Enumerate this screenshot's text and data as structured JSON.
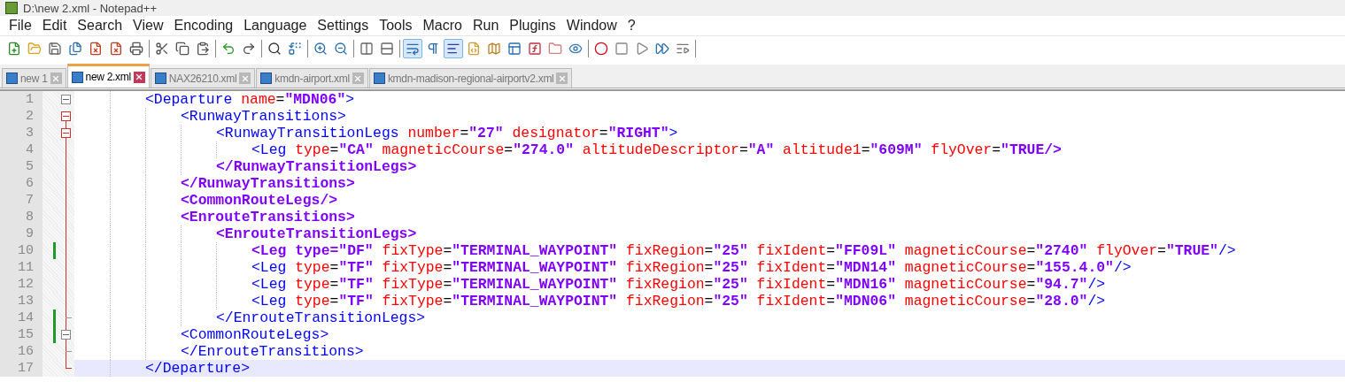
{
  "window": {
    "title": "D:\\new 2.xml - Notepad++"
  },
  "menu": [
    "File",
    "Edit",
    "Search",
    "View",
    "Encoding",
    "Language",
    "Settings",
    "Tools",
    "Macro",
    "Run",
    "Plugins",
    "Window",
    "?"
  ],
  "toolbar": [
    [
      {
        "pressed": false
      },
      {
        "pressed": false
      },
      {
        "pressed": false
      },
      {
        "pressed": false
      },
      {
        "pressed": false
      },
      {
        "pressed": false
      },
      {
        "pressed": false
      }
    ],
    [
      {
        "pressed": false
      },
      {
        "pressed": false
      },
      {
        "pressed": false
      }
    ],
    [
      {
        "pressed": false
      },
      {
        "pressed": false
      }
    ],
    [
      {
        "pressed": false
      },
      {
        "pressed": false
      }
    ],
    [
      {
        "pressed": false
      },
      {
        "pressed": false
      }
    ],
    [
      {
        "pressed": false
      },
      {
        "pressed": false
      }
    ],
    [
      {
        "pressed": true
      },
      {
        "pressed": false
      },
      {
        "pressed": true
      },
      {
        "pressed": false
      },
      {
        "pressed": false
      },
      {
        "pressed": false
      },
      {
        "pressed": false
      },
      {
        "pressed": false
      },
      {
        "pressed": false
      }
    ],
    [
      {
        "pressed": false
      },
      {
        "pressed": false
      },
      {
        "pressed": false
      },
      {
        "pressed": false
      },
      {
        "pressed": false
      }
    ]
  ],
  "tabs": [
    {
      "label": "new 1",
      "selected": false
    },
    {
      "label": "new 2.xml",
      "selected": true
    },
    {
      "label": "NAX26210.xml",
      "selected": false
    },
    {
      "label": "kmdn-airport.xml",
      "selected": false
    },
    {
      "label": "kmdn-madison-regional-airportv2.xml",
      "selected": false
    }
  ],
  "editor": {
    "lines": [
      {
        "number": "1",
        "kind": "box",
        "in_block": false,
        "changed": false,
        "current": false,
        "tokens": [
          {
            "kind": "tag",
            "text": "<Departure"
          },
          {
            "kind": "attr",
            "text": " name"
          },
          {
            "kind": "eq",
            "text": "="
          },
          {
            "kind": "value",
            "text": "\"MDN06\""
          },
          {
            "kind": "tag",
            "text": ">"
          }
        ],
        "children": [
          {
            "number": "2",
            "kind": "box-active",
            "in_block": true,
            "changed": false,
            "current": false,
            "tokens": [
              {
                "kind": "tag",
                "text": "<RunwayTransitions>"
              }
            ],
            "children": [
              {
                "number": "3",
                "kind": "box-active",
                "in_block": true,
                "changed": false,
                "current": false,
                "tokens": [
                  {
                    "kind": "tag",
                    "text": "<RunwayTransitionLegs"
                  },
                  {
                    "kind": "attr",
                    "text": " number"
                  },
                  {
                    "kind": "eq",
                    "text": "="
                  },
                  {
                    "kind": "value",
                    "text": "\"27\""
                  },
                  {
                    "kind": "attr",
                    "text": " designator"
                  },
                  {
                    "kind": "eq",
                    "text": "="
                  },
                  {
                    "kind": "value",
                    "text": "\"RIGHT\""
                  },
                  {
                    "kind": "tag",
                    "text": ">"
                  }
                ],
                "children": [
                  {
                    "number": "4",
                    "in_block": true,
                    "changed": false,
                    "current": false,
                    "tokens": [
                      {
                        "kind": "tag",
                        "text": "<Leg"
                      },
                      {
                        "kind": "attr",
                        "text": " type"
                      },
                      {
                        "kind": "eq",
                        "text": "="
                      },
                      {
                        "kind": "value",
                        "text": "\"CA\""
                      },
                      {
                        "kind": "attr",
                        "text": " magneticCourse"
                      },
                      {
                        "kind": "eq",
                        "text": "="
                      },
                      {
                        "kind": "value",
                        "text": "\"274.0\""
                      },
                      {
                        "kind": "attr",
                        "text": " altitudeDescriptor"
                      },
                      {
                        "kind": "eq",
                        "text": "="
                      },
                      {
                        "kind": "value",
                        "text": "\"A\""
                      },
                      {
                        "kind": "attr",
                        "text": " altitude1"
                      },
                      {
                        "kind": "eq",
                        "text": "="
                      },
                      {
                        "kind": "value",
                        "text": "\"609M\""
                      },
                      {
                        "kind": "attr",
                        "text": " flyOver"
                      },
                      {
                        "kind": "eq",
                        "text": "="
                      },
                      {
                        "kind": "value",
                        "text": "\"TRUE/>"
                      }
                    ]
                  }
                ]
              },
              {
                "number": "5",
                "in_block": true,
                "changed": false,
                "current": false,
                "tokens": [
                  {
                    "kind": "value",
                    "text": "</RunwayTransitionLegs>"
                  }
                ]
              }
            ]
          },
          {
            "number": "6",
            "in_block": true,
            "changed": false,
            "current": false,
            "tokens": [
              {
                "kind": "value",
                "text": "</RunwayTransitions>"
              }
            ]
          },
          {
            "number": "7",
            "in_block": true,
            "changed": false,
            "current": false,
            "tokens": [
              {
                "kind": "value",
                "text": "<CommonRouteLegs/>"
              }
            ]
          },
          {
            "number": "8",
            "in_block": true,
            "changed": false,
            "current": false,
            "tokens": [
              {
                "kind": "value",
                "text": "<EnrouteTransitions>"
              }
            ],
            "children": [
              {
                "number": "9",
                "in_block": true,
                "changed": false,
                "current": false,
                "tokens": [
                  {
                    "kind": "value",
                    "text": "<EnrouteTransitionLegs>"
                  }
                ],
                "children": [
                  {
                    "number": "10",
                    "in_block": true,
                    "changed": true,
                    "current": false,
                    "tokens": [
                      {
                        "kind": "value",
                        "text": "<Leg type=\"DF\""
                      },
                      {
                        "kind": "attr",
                        "text": " fixType"
                      },
                      {
                        "kind": "eq",
                        "text": "="
                      },
                      {
                        "kind": "value",
                        "text": "\"TERMINAL_WAYPOINT\""
                      },
                      {
                        "kind": "attr",
                        "text": " fixRegion"
                      },
                      {
                        "kind": "eq",
                        "text": "="
                      },
                      {
                        "kind": "value",
                        "text": "\"25\""
                      },
                      {
                        "kind": "attr",
                        "text": " fixIdent"
                      },
                      {
                        "kind": "eq",
                        "text": "="
                      },
                      {
                        "kind": "value",
                        "text": "\"FF09L\""
                      },
                      {
                        "kind": "attr",
                        "text": " magneticCourse"
                      },
                      {
                        "kind": "eq",
                        "text": "="
                      },
                      {
                        "kind": "value",
                        "text": "\"2740\""
                      },
                      {
                        "kind": "attr",
                        "text": " flyOver"
                      },
                      {
                        "kind": "eq",
                        "text": "="
                      },
                      {
                        "kind": "value",
                        "text": "\"TRUE\""
                      },
                      {
                        "kind": "tag",
                        "text": "/>"
                      }
                    ]
                  },
                  {
                    "number": "11",
                    "in_block": true,
                    "changed": false,
                    "current": false,
                    "tokens": [
                      {
                        "kind": "tag",
                        "text": "<Leg"
                      },
                      {
                        "kind": "attr",
                        "text": " type"
                      },
                      {
                        "kind": "eq",
                        "text": "="
                      },
                      {
                        "kind": "value",
                        "text": "\"TF\""
                      },
                      {
                        "kind": "attr",
                        "text": " fixType"
                      },
                      {
                        "kind": "eq",
                        "text": "="
                      },
                      {
                        "kind": "value",
                        "text": "\"TERMINAL_WAYPOINT\""
                      },
                      {
                        "kind": "attr",
                        "text": " fixRegion"
                      },
                      {
                        "kind": "eq",
                        "text": "="
                      },
                      {
                        "kind": "value",
                        "text": "\"25\""
                      },
                      {
                        "kind": "attr",
                        "text": " fixIdent"
                      },
                      {
                        "kind": "eq",
                        "text": "="
                      },
                      {
                        "kind": "value",
                        "text": "\"MDN14\""
                      },
                      {
                        "kind": "attr",
                        "text": " magneticCourse"
                      },
                      {
                        "kind": "eq",
                        "text": "="
                      },
                      {
                        "kind": "value",
                        "text": "\"155.4.0\""
                      },
                      {
                        "kind": "tag",
                        "text": "/>"
                      }
                    ]
                  },
                  {
                    "number": "12",
                    "in_block": true,
                    "changed": false,
                    "current": false,
                    "tokens": [
                      {
                        "kind": "tag",
                        "text": "<Leg"
                      },
                      {
                        "kind": "attr",
                        "text": " type"
                      },
                      {
                        "kind": "eq",
                        "text": "="
                      },
                      {
                        "kind": "value",
                        "text": "\"TF\""
                      },
                      {
                        "kind": "attr",
                        "text": " fixType"
                      },
                      {
                        "kind": "eq",
                        "text": "="
                      },
                      {
                        "kind": "value",
                        "text": "\"TERMINAL_WAYPOINT\""
                      },
                      {
                        "kind": "attr",
                        "text": " fixRegion"
                      },
                      {
                        "kind": "eq",
                        "text": "="
                      },
                      {
                        "kind": "value",
                        "text": "\"25\""
                      },
                      {
                        "kind": "attr",
                        "text": " fixIdent"
                      },
                      {
                        "kind": "eq",
                        "text": "="
                      },
                      {
                        "kind": "value",
                        "text": "\"MDN16\""
                      },
                      {
                        "kind": "attr",
                        "text": " magneticCourse"
                      },
                      {
                        "kind": "eq",
                        "text": "="
                      },
                      {
                        "kind": "value",
                        "text": "\"94.7\""
                      },
                      {
                        "kind": "tag",
                        "text": "/>"
                      }
                    ]
                  },
                  {
                    "number": "13",
                    "in_block": true,
                    "changed": false,
                    "current": false,
                    "tokens": [
                      {
                        "kind": "tag",
                        "text": "<Leg"
                      },
                      {
                        "kind": "attr",
                        "text": " type"
                      },
                      {
                        "kind": "eq",
                        "text": "="
                      },
                      {
                        "kind": "value",
                        "text": "\"TF\""
                      },
                      {
                        "kind": "attr",
                        "text": " fixType"
                      },
                      {
                        "kind": "eq",
                        "text": "="
                      },
                      {
                        "kind": "value",
                        "text": "\"TERMINAL_WAYPOINT\""
                      },
                      {
                        "kind": "attr",
                        "text": " fixRegion"
                      },
                      {
                        "kind": "eq",
                        "text": "="
                      },
                      {
                        "kind": "value",
                        "text": "\"25\""
                      },
                      {
                        "kind": "attr",
                        "text": " fixIdent"
                      },
                      {
                        "kind": "eq",
                        "text": "="
                      },
                      {
                        "kind": "value",
                        "text": "\"MDN06\""
                      },
                      {
                        "kind": "attr",
                        "text": " magneticCourse"
                      },
                      {
                        "kind": "eq",
                        "text": "="
                      },
                      {
                        "kind": "value",
                        "text": "\"28.0\""
                      },
                      {
                        "kind": "tag",
                        "text": "/>"
                      }
                    ]
                  }
                ]
              },
              {
                "number": "14",
                "kind": "tick",
                "in_block": true,
                "changed": true,
                "current": false,
                "tokens": [
                  {
                    "kind": "tag",
                    "text": "</EnrouteTransitionLegs>"
                  }
                ]
              }
            ]
          },
          {
            "number": "15",
            "kind": "box",
            "in_block": true,
            "changed": true,
            "current": false,
            "tokens": [
              {
                "kind": "tag",
                "text": "<CommonRouteLegs>"
              }
            ]
          },
          {
            "number": "16",
            "kind": "tick",
            "in_block": true,
            "changed": false,
            "current": false,
            "tokens": [
              {
                "kind": "tag",
                "text": "</EnrouteTransitions>"
              }
            ]
          }
        ]
      },
      {
        "number": "17",
        "kind": "end",
        "in_block": true,
        "changed": false,
        "current": true,
        "tokens": [
          {
            "kind": "tag",
            "text": "</Departure>"
          }
        ]
      }
    ]
  }
}
